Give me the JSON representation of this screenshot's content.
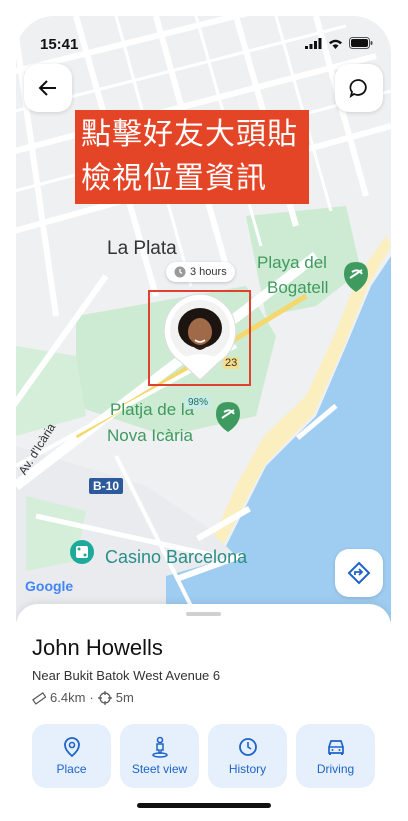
{
  "status_bar": {
    "time": "15:41"
  },
  "banner": {
    "line1": "點擊好友大頭貼",
    "line2": "檢視位置資訊"
  },
  "map": {
    "labels": {
      "la_plata": "La Plata",
      "playa_line1": "Playa del",
      "playa_line2": "Bogatell",
      "platja_line1": "Platja de la",
      "platja_line2": "Nova Icària",
      "avenue": "Av. d'Icària",
      "casino": "Casino Barcelona",
      "road_tag": "B-10",
      "road_number": "23",
      "google": "Google"
    },
    "time_pill": "3 hours",
    "battery": "98%"
  },
  "friend": {
    "name": "John Howells",
    "location": "Near Bukit Batok West Avenue 6",
    "distance": "6.4km",
    "separator": "·",
    "accuracy": "5m"
  },
  "actions": [
    {
      "label": "Place",
      "icon": "place-pin-icon"
    },
    {
      "label": "Steet view",
      "icon": "street-view-icon"
    },
    {
      "label": "History",
      "icon": "history-icon"
    },
    {
      "label": "Driving",
      "icon": "car-icon"
    }
  ],
  "colors": {
    "accent": "#1d63c9",
    "banner": "#e54527",
    "water": "#9fcdf2",
    "park": "#cdebd2",
    "sand": "#fbeebf"
  }
}
